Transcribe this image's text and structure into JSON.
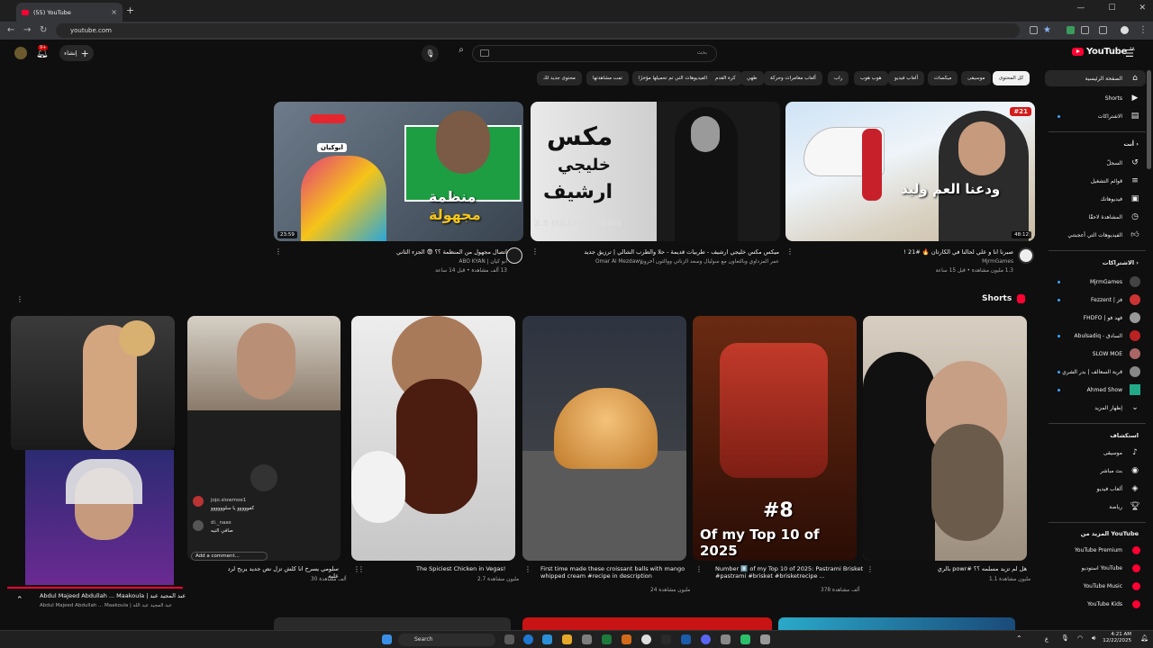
{
  "browser": {
    "tab_title": "(55) YouTube",
    "url": "youtube.com",
    "new_tab": "+",
    "tab_close": "×"
  },
  "header": {
    "logo": "YouTube",
    "logo_sup": "SA",
    "search_placeholder": "بحث",
    "search_value": "",
    "create_label": "إنشاء",
    "notif_count": "9+"
  },
  "chips": [
    {
      "label": "كل المحتوى",
      "active": true
    },
    {
      "label": "موسيقى"
    },
    {
      "label": "ميكسات"
    },
    {
      "label": "ألعاب فيديو"
    },
    {
      "label": "هوب هوب"
    },
    {
      "label": "راب"
    },
    {
      "label": "ألعاب مغامرات وحركة"
    },
    {
      "label": "طهي"
    },
    {
      "label": "كرة القدم"
    },
    {
      "label": "الفيديوهات التي تم تحميلها مؤخرًا"
    },
    {
      "label": "تمت مشاهدتها"
    },
    {
      "label": "محتوى جديد لك"
    }
  ],
  "sidebar": {
    "home": "الصفحة الرئيسية",
    "shorts": "Shorts",
    "subscriptions_item": "الاشتراكات",
    "you_header": "أنت",
    "history": "السجلّ",
    "playlists": "قوائم التشغيل",
    "your_videos": "فيديوهاتك",
    "watch_later": "المشاهدة لاحقًا",
    "liked": "الفيديوهات التي أعجبتني",
    "subs_header": "الاشتراكات",
    "channels": [
      {
        "name": "MjrmGames",
        "color": "#444"
      },
      {
        "name": "Fezzent | فز",
        "color": "#c33"
      },
      {
        "name": "FHDFO | فهد فو",
        "color": "#999"
      },
      {
        "name": "Abulsadiq - السادق",
        "color": "#b22"
      },
      {
        "name": "SLOW MOE",
        "color": "#a66"
      },
      {
        "name": "قرية السعالف | بدر الشري",
        "color": "#888"
      },
      {
        "name": "Ahmed Show",
        "color": "#2a8"
      }
    ],
    "show_more": "إظهار المزيد",
    "explore_header": "استكشاف",
    "explore": [
      "موسيقى",
      "بث مباشر",
      "ألعاب فيديو",
      "رياضة"
    ],
    "more_header": "المزيد من YouTube",
    "more": [
      "YouTube Premium",
      "استوديو YouTube",
      "YouTube Music",
      "YouTube Kids"
    ]
  },
  "videos": [
    {
      "title": "صبرنا انا و علي لحالنا في الكارتان 🔥 #21 !",
      "channel": "MjrmGames",
      "meta": "1.3 مليون مشاهدة • قبل 15 ساعة",
      "duration": "48:12",
      "overlay": "ودعنا العم وليد",
      "badge": "#21"
    },
    {
      "title": "ميكس مكس خليجي ارشيف - طربيات قديمة - حلا والطرب الشالي | ترزيق جديد",
      "channel": "Omar Al Mezdawy",
      "channel_sub": "عمر المزداوي وبالتعاون مع سوليال وسعد الزناتي ووالثون آخرون",
      "meta": "",
      "overlay1": "مكس",
      "overlay2": "خليجي",
      "overlay3": "ارشيف",
      "views_banner": "2.5 MILLION VIEWS"
    },
    {
      "title": "اتصال مجهول من المنظمة ؟؟ 😨 الجزء الثاني",
      "channel": "ابو كيان | ABO KYAN",
      "meta": "13 ألف مشاهدة • قبل 14 ساعة",
      "duration": "23:59",
      "overlay1": "منظمة",
      "overlay2": "مجهولة",
      "name_tag": "ابوكيان"
    }
  ],
  "shorts": {
    "title": "Shorts",
    "items": [
      {
        "title": "هل لم تزيد مسلمه ؟؟ #powr بالري",
        "meta": "1.1 مليون مشاهدة"
      },
      {
        "title": "Number 8️⃣ of my Top 10 of 2025: Pastrami Brisket #pastrami #brisket #brisketrecipe ...",
        "meta": "378 ألف مشاهدة",
        "overlay1": "#8",
        "overlay2": "Of my Top 10 of 2025"
      },
      {
        "title": "First time made these croissant balls with mango whipped cream #recipe in description",
        "meta": "24 مليون مشاهدة"
      },
      {
        "title": "The Spiciest Chicken in Vegas!",
        "meta": "2.7 مليون مشاهدة"
      },
      {
        "title": "سلومي يسرح انا كلش تزل نص جديد يربح لرد عليه",
        "meta": "30 ألف مشاهدة",
        "comment1_user": "jojo.slowmoe1",
        "comment1_text": "كفووووو يا سلوووووو",
        "comment2_user": "di._naas",
        "comment2_text": "صافي النيه",
        "add_comment": "Add a comment..."
      }
    ]
  },
  "miniplayer": {
    "title": "Abdul Majeed Abdullah ... Maakoula | عبد المجيد عبد",
    "subtitle": "Abdul Majeed Abdullah ... Maakoula | عبد المجيد عبد الله"
  },
  "taskbar": {
    "search_label": "Search",
    "time": "4:21 AM",
    "date": "12/22/2025",
    "lang": "ع"
  }
}
